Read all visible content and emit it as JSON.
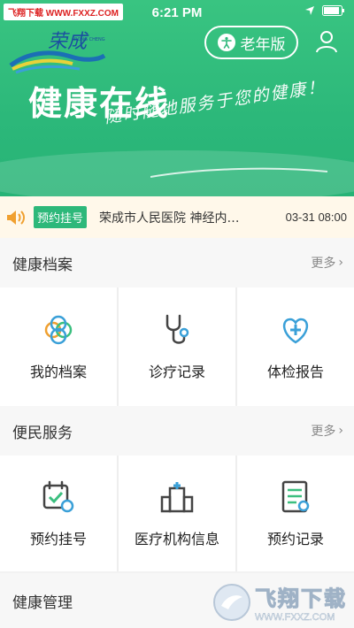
{
  "status_bar": {
    "watermark": "飞翔下载 WWW.FXXZ.COM",
    "time": "6:21 PM"
  },
  "header": {
    "logo_text": "荣成",
    "logo_sub": "RONG CHENG",
    "senior_mode_label": "老年版",
    "hero_title": "健康在线",
    "hero_slogan": "随时随地服务于您的健康！"
  },
  "notice": {
    "tag": "预约挂号",
    "text": "荣成市人民医院 神经内…",
    "time": "03-31 08:00"
  },
  "sections": [
    {
      "title": "健康档案",
      "more": "更多",
      "items": [
        {
          "label": "我的档案",
          "icon": "profile-icon"
        },
        {
          "label": "诊疗记录",
          "icon": "stethoscope-icon"
        },
        {
          "label": "体检报告",
          "icon": "checkup-icon"
        }
      ]
    },
    {
      "title": "便民服务",
      "more": "更多",
      "items": [
        {
          "label": "预约挂号",
          "icon": "calendar-icon"
        },
        {
          "label": "医疗机构信息",
          "icon": "hospital-icon"
        },
        {
          "label": "预约记录",
          "icon": "record-icon"
        }
      ]
    },
    {
      "title": "健康管理"
    }
  ],
  "bottom_watermark": {
    "brand": "飞翔下载",
    "url": "WWW.FXXZ.COM"
  },
  "colors": {
    "primary": "#2db87a",
    "accent": "#f0a030",
    "notice_bg": "#fff8ea"
  }
}
